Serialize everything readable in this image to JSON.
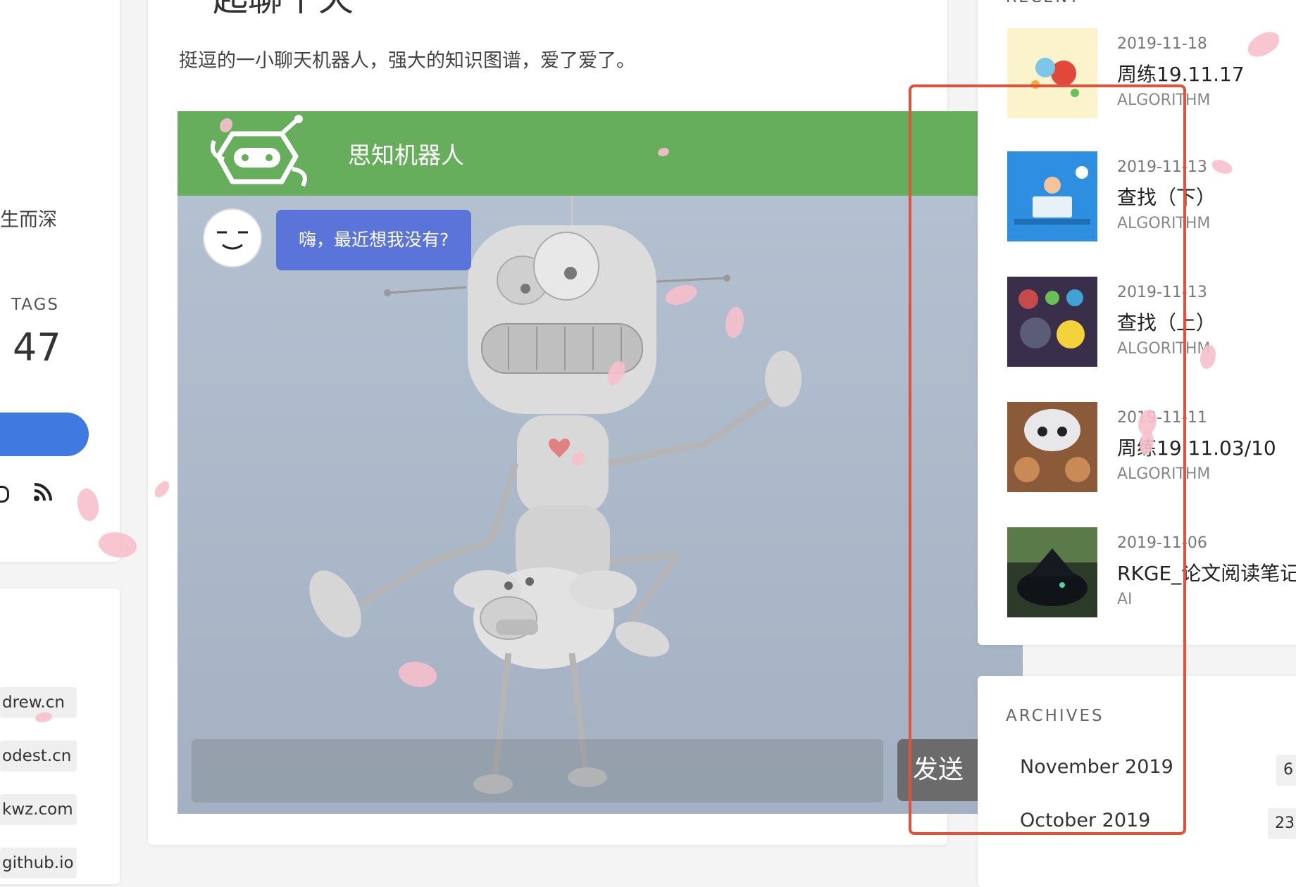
{
  "sidebar": {
    "truncated_text": "生而深",
    "tags_label": "TAGS",
    "tags_count": "47",
    "links": [
      "drew.cn",
      "odest.cn",
      "kwz.com",
      "github.io"
    ]
  },
  "post": {
    "title": "一起聊个天",
    "description": "挺逗的一小聊天机器人，强大的知识图谱，爱了爱了。"
  },
  "chat": {
    "title": "思知机器人",
    "message": "嗨，最近想我没有?",
    "input_placeholder": "",
    "send_label": "发送"
  },
  "recent": {
    "label": "RECENT",
    "items": [
      {
        "date": "2019-11-18",
        "title": "周练19.11.17",
        "category": "ALGORITHM"
      },
      {
        "date": "2019-11-13",
        "title": "查找（下）",
        "category": "ALGORITHM"
      },
      {
        "date": "2019-11-13",
        "title": "查找（上）",
        "category": "ALGORITHM"
      },
      {
        "date": "2019-11-11",
        "title": "周练19.11.03/10",
        "category": "ALGORITHM"
      },
      {
        "date": "2019-11-06",
        "title": "RKGE_论文阅读笔记",
        "category": "AI"
      }
    ]
  },
  "archives": {
    "label": "ARCHIVES",
    "items": [
      {
        "month": "November 2019",
        "count": "6"
      },
      {
        "month": "October 2019",
        "count": "23"
      }
    ]
  },
  "colors": {
    "header_green": "#66ad5c",
    "bubble_blue": "#5b74d9",
    "sidebar_button": "#3f7ae0",
    "highlight_red": "#e0523a"
  }
}
